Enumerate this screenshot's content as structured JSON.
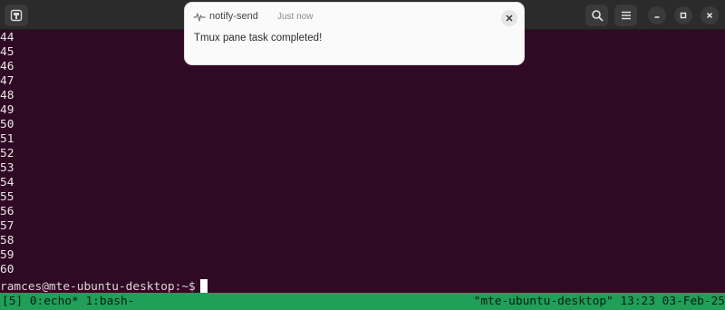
{
  "window": {
    "icons": {
      "new_tab": "new-tab-icon",
      "search": "search-icon",
      "menu": "hamburger-menu-icon",
      "minimize": "minimize-icon",
      "maximize": "maximize-icon",
      "close": "close-icon"
    }
  },
  "terminal": {
    "background": "#300a24",
    "lines": [
      "44",
      "45",
      "46",
      "47",
      "48",
      "49",
      "50",
      "51",
      "52",
      "53",
      "54",
      "55",
      "56",
      "57",
      "58",
      "59",
      "60"
    ],
    "prompt": {
      "user_host": "ramces@mte-ubuntu-desktop",
      "path": ":~",
      "symbol": "$"
    }
  },
  "tmux_status": {
    "background": "#1f9f58",
    "left": "[5] 0:echo* 1:bash-",
    "right": "\"mte-ubuntu-desktop\" 13:23 03-Feb-25"
  },
  "notification": {
    "app_name": "notify-send",
    "time": "Just now",
    "message": "Tmux pane task completed!",
    "icon": "notify-send-icon",
    "close_icon": "close-icon"
  }
}
